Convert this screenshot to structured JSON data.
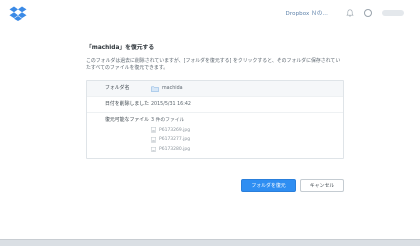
{
  "header": {
    "upgrade_label": "Dropbox Ｎの...",
    "icons": [
      "dropbox-logo-icon",
      "bell-icon",
      "account-icon"
    ]
  },
  "dialog": {
    "title": "「machida」を復元する",
    "description": "このフォルダは過去に削除されていますが、[フォルダを復元する] をクリックすると、そのフォルダに保存されていたすべてのファイルを復元できます。",
    "rows": [
      {
        "label": "フォルダ名",
        "value": "machida"
      },
      {
        "label": "日付を削除しました",
        "value": "2015/5/31 16:42"
      },
      {
        "label": "復元可能なファイル",
        "value": "3 件のファイル"
      }
    ],
    "files": [
      "P6173269.jpg",
      "P6173277.jpg",
      "P6173280.jpg"
    ],
    "restore_button": "フォルダを復元",
    "cancel_button": "キャンセル"
  },
  "colors": {
    "accent": "#2f8ef2",
    "background": "#dadfe4",
    "dropbox_blue": "#0061fe"
  }
}
